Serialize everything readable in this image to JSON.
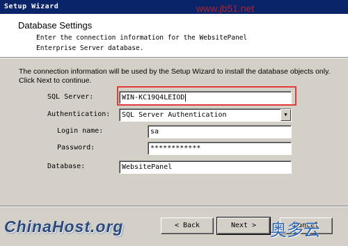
{
  "window": {
    "title": "Setup Wizard"
  },
  "watermark": {
    "site": "www.jb51.net",
    "logo": "ChinaHost.org",
    "logo_cn": "奥多云"
  },
  "header": {
    "title": "Database Settings",
    "description": "Enter the connection information for the WebsitePanel Enterprise Server database."
  },
  "intro": "The connection information will be used by the Setup Wizard to install the database objects only. Click Next to continue.",
  "form": {
    "sql_server": {
      "label": "SQL Server:",
      "value": "WIN-KC19Q4LEIOD"
    },
    "authentication": {
      "label": "Authentication:",
      "value": "SQL Server Authentication"
    },
    "login_name": {
      "label": "Login name:",
      "value": "sa"
    },
    "password": {
      "label": "Password:",
      "value": "************"
    },
    "database": {
      "label": "Database:",
      "value": "WebsitePanel"
    }
  },
  "buttons": {
    "back": "< Back",
    "next": "Next >",
    "cancel": "Cancel"
  },
  "colors": {
    "title_bar": "#0a246a",
    "highlight": "#e23a3a",
    "dialog_bg": "#d4d0c8"
  }
}
